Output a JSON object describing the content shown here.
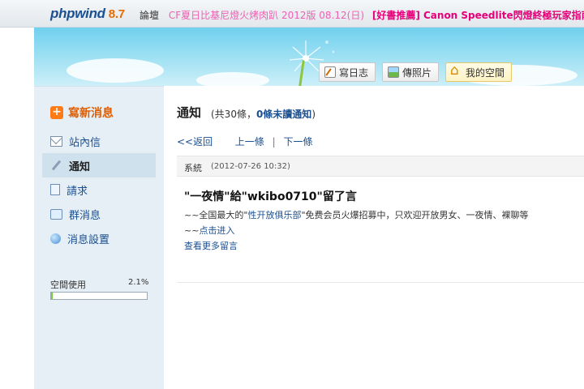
{
  "header": {
    "logo_brand": "phpwind",
    "logo_version": "8.7",
    "forum_label": "論壇",
    "ticker_1": "CF夏日比基尼燈火烤肉趴  2012版 08.12(日)",
    "ticker_2": "[好書推薦] Canon Speedlite閃燈終極玩家指南"
  },
  "actions": {
    "write_diary": "寫日志",
    "upload_photo": "傳照片",
    "my_space": "我的空間"
  },
  "sidebar": {
    "new_message": "寫新消息",
    "items": [
      {
        "label": "站內信",
        "icon": "mail-icon"
      },
      {
        "label": "通知",
        "icon": "pencil-icon"
      },
      {
        "label": "請求",
        "icon": "document-icon"
      },
      {
        "label": "群消息",
        "icon": "chat-icon"
      },
      {
        "label": "消息設置",
        "icon": "globe-icon"
      }
    ],
    "space_label": "空間使用",
    "space_percent_text": "2.1%",
    "space_fraction": 0.021
  },
  "main": {
    "title": "通知",
    "info_prefix": "(共30條，",
    "info_unread": "0條未讀通知",
    "info_suffix": ")",
    "back_link": "<<返回",
    "prev_link": "上一條",
    "next_link": "下一條",
    "sender": "系統",
    "timestamp": "(2012-07-26 10:32)",
    "message_title": "\"一夜情\"給\"wkibo0710\"留了言",
    "body_line1_prefix": "~~全国最大的\"",
    "body_line1_link": "性开放俱乐部",
    "body_line1_suffix": "\"免费会员火爆招募中，只欢迎开放男女、一夜情、裸聊等",
    "body_line2_prefix": "~~",
    "body_line2_link": "点击进入",
    "more_link": "查看更多留言"
  },
  "colors": {
    "brand_blue": "#1a4f91",
    "accent_orange": "#e05d00",
    "ticker_pink": "#e6007a",
    "sidebar_bg": "#e5eff5",
    "progress_green": "#7ccd32"
  }
}
